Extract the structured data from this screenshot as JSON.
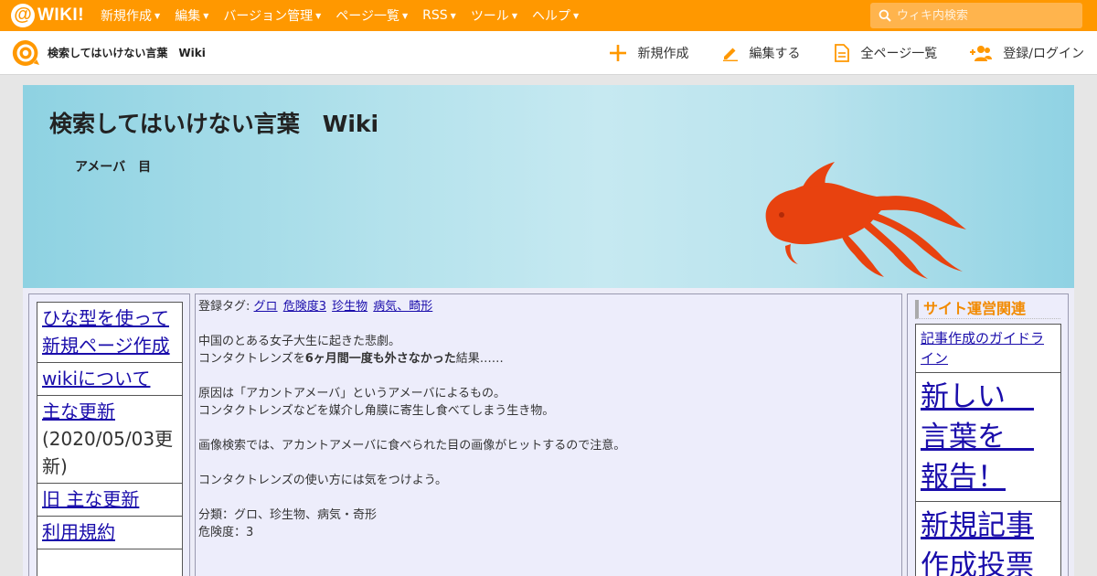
{
  "topbar": {
    "logo_text": "WIKI!",
    "menu": [
      {
        "label": "新規作成"
      },
      {
        "label": "編集"
      },
      {
        "label": "バージョン管理"
      },
      {
        "label": "ページ一覧"
      },
      {
        "label": "RSS"
      },
      {
        "label": "ツール"
      },
      {
        "label": "ヘルプ"
      }
    ],
    "search_placeholder": "ウィキ内検索"
  },
  "subbar": {
    "site_name": "検索してはいけない言葉　Wiki",
    "actions": [
      {
        "label": "新規作成",
        "icon": "plus-icon"
      },
      {
        "label": "編集する",
        "icon": "pencil-icon"
      },
      {
        "label": "全ページ一覧",
        "icon": "document-icon"
      },
      {
        "label": "登録/ログイン",
        "icon": "add-user-icon"
      }
    ]
  },
  "banner": {
    "title": "検索してはいけない言葉　Wiki",
    "subtitle": "アメーバ　目"
  },
  "left_menu": {
    "items": [
      {
        "label": "ひな型を使って新規ページ作成",
        "note": ""
      },
      {
        "label": "wikiについて",
        "note": ""
      },
      {
        "label": "主な更新",
        "note": "(2020/05/03更新)"
      },
      {
        "label": "旧 主な更新",
        "note": ""
      },
      {
        "label": "利用規約",
        "note": ""
      }
    ]
  },
  "article": {
    "tags_label": "登録タグ:",
    "tags": [
      "グロ",
      "危険度3",
      "珍生物",
      "病気、畸形"
    ],
    "line1": "中国のとある女子大生に起きた悲劇。",
    "line2_pre": "コンタクトレンズを",
    "line2_bold": "6ヶ月間一度も外さなかった",
    "line2_post": "結果……",
    "line3": "原因は「アカントアメーバ」というアメーバによるもの。",
    "line4": "コンタクトレンズなどを媒介し角膜に寄生し食べてしまう生き物。",
    "line5": "画像検索では、アカントアメーバに食べられた目の画像がヒットするので注意。",
    "line6": "コンタクトレンズの使い方には気をつけよう。",
    "line7": "分類：グロ、珍生物、病気・奇形",
    "line8": "危険度：3"
  },
  "right_sidebar": {
    "heading": "サイト運営関連",
    "links": [
      {
        "label": "記事作成のガイドライン"
      },
      {
        "label": "新しい　言葉を　報告！"
      },
      {
        "label": "新規記事作成投票"
      }
    ]
  },
  "colors": {
    "topbar": "#ff9800",
    "accent": "#f28a00",
    "link": "#1a0dab",
    "goldfish": "#e8420f"
  }
}
